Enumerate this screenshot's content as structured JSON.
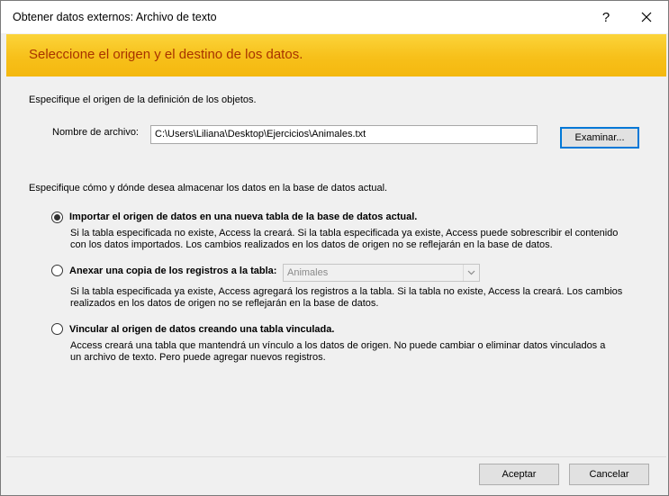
{
  "window": {
    "title": "Obtener datos externos: Archivo de texto",
    "help_glyph": "?",
    "close_icon": "close-icon"
  },
  "banner": {
    "text": "Seleccione el origen y el destino de los datos."
  },
  "source": {
    "section_label": "Especifique el origen de la definición de los objetos.",
    "filename_label": "Nombre de archivo:",
    "filename_value": "C:\\Users\\Liliana\\Desktop\\Ejercicios\\Animales.txt",
    "browse_label": "Examinar..."
  },
  "destination": {
    "section_label": "Especifique cómo y dónde desea almacenar los datos en la base de datos actual.",
    "options": [
      {
        "label": "Importar el origen de datos en una nueva tabla de la base de datos actual.",
        "selected": true,
        "desc": [
          "Si la tabla especificada no existe, Access la creará. Si la tabla especificada ya existe, Access puede sobrescribir el contenido",
          "con los datos importados. Los cambios realizados en los datos de origen no se reflejarán en la base de datos."
        ]
      },
      {
        "label": "Anexar una copia de los registros a la tabla:",
        "selected": false,
        "table_select": "Animales",
        "desc": [
          "Si la tabla especificada ya existe, Access agregará los registros a la tabla. Si la tabla no existe, Access la creará. Los cambios",
          "realizados en los datos de origen no se reflejarán en la base de datos."
        ]
      },
      {
        "label": "Vincular al origen de datos creando una tabla vinculada.",
        "selected": false,
        "desc": [
          "Access creará una tabla que mantendrá un vínculo a los datos de origen. No puede cambiar o eliminar datos vinculados a",
          "un archivo de texto. Pero puede agregar nuevos registros."
        ]
      }
    ]
  },
  "footer": {
    "accept_label": "Aceptar",
    "cancel_label": "Cancelar"
  },
  "colors": {
    "banner_bg": "#f7c01a",
    "banner_text": "#a83300",
    "focus_border": "#0078d7"
  }
}
